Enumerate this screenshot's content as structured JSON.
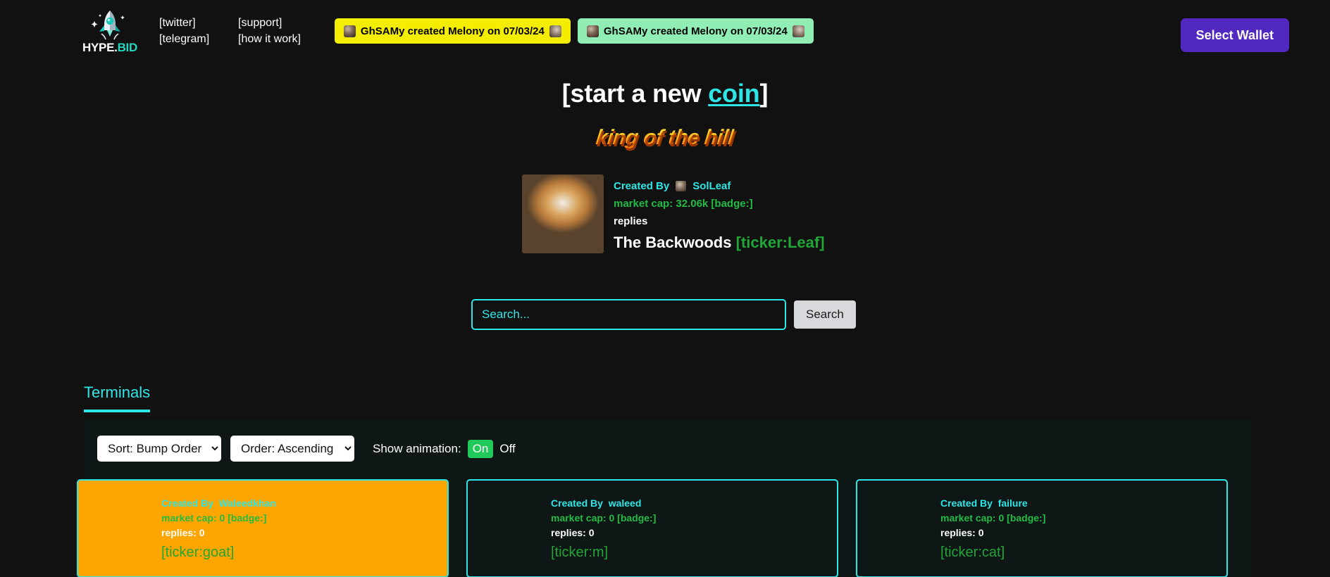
{
  "brand": {
    "name_part1": "HYPE.",
    "name_part2": "BID",
    "logo_icon": "rocket-icon"
  },
  "nav": {
    "links": [
      {
        "label": "[twitter]"
      },
      {
        "label": "[telegram]"
      },
      {
        "label": "[support]"
      },
      {
        "label": "[how it work]"
      }
    ]
  },
  "banners": [
    {
      "text": "GhSAMy created Melony on 07/03/24",
      "color": "#f5ed00"
    },
    {
      "text": "GhSAMy created Melony on 07/03/24",
      "color": "#90eeb4"
    }
  ],
  "wallet": {
    "label": "Select Wallet",
    "color": "#5229c0"
  },
  "hero": {
    "title_prefix": "[start a new ",
    "title_link": "coin",
    "title_suffix": "]",
    "king_of_the_hill": "king of the hill"
  },
  "featured": {
    "created_by_label": "Created By",
    "creator": "SolLeaf",
    "market_cap": "market cap: 32.06k [badge:]",
    "replies": "replies",
    "name": "The Backwoods",
    "ticker": "[ticker:Leaf]"
  },
  "search": {
    "placeholder": "Search...",
    "value": "",
    "button_label": "Search"
  },
  "tabs": [
    {
      "label": "Terminals",
      "active": true
    }
  ],
  "controls": {
    "sort": {
      "selected": "Sort: Bump Order",
      "options": [
        "Sort: Bump Order"
      ]
    },
    "order": {
      "selected": "Order: Ascending",
      "options": [
        "Order: Ascending"
      ]
    },
    "animation_label": "Show animation:",
    "animation_on": "On",
    "animation_off": "Off",
    "animation_active_color": "#21c85a"
  },
  "cards": [
    {
      "created_by_label": "Created By",
      "creator": "Waleedkhan",
      "market_cap": "market cap: 0 [badge:]",
      "replies": "replies: 0",
      "ticker": "[ticker:goat]",
      "highlight": true,
      "bg_color": "#ffa500"
    },
    {
      "created_by_label": "Created By",
      "creator": "waleed",
      "market_cap": "market cap: 0 [badge:]",
      "replies": "replies: 0",
      "ticker": "[ticker:m]",
      "highlight": false,
      "bg_color": "#0f1716"
    },
    {
      "created_by_label": "Created By",
      "creator": "failure",
      "market_cap": "market cap: 0 [badge:]",
      "replies": "replies: 0",
      "ticker": "[ticker:cat]",
      "highlight": false,
      "bg_color": "#0f1716"
    }
  ]
}
